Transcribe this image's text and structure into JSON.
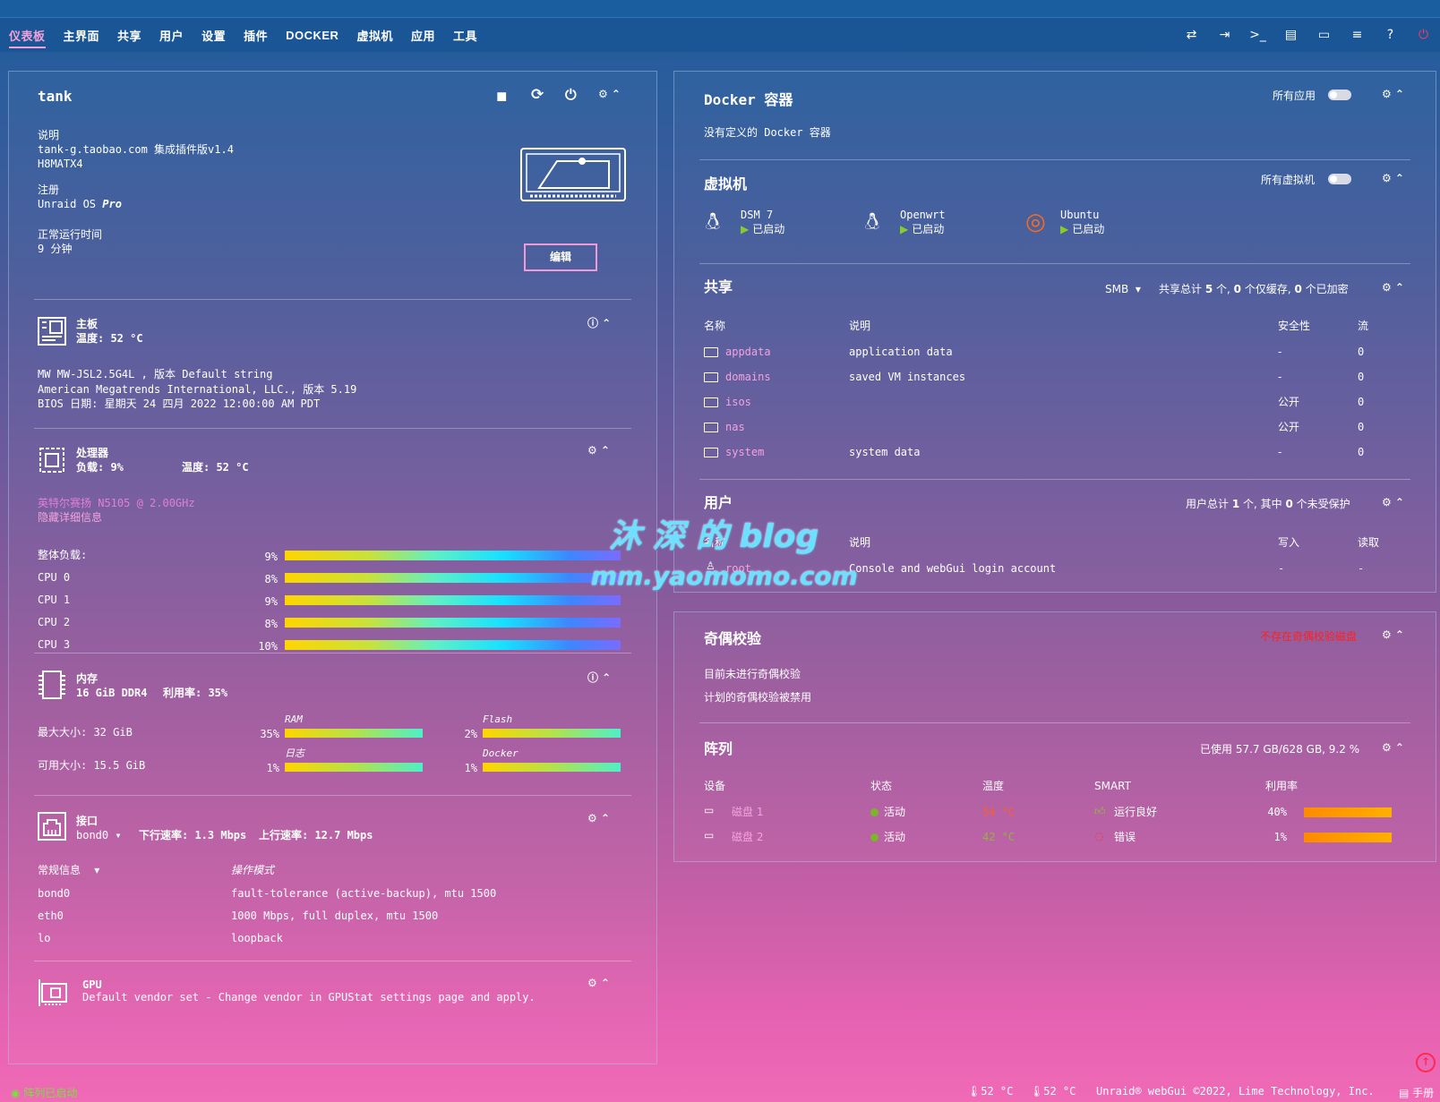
{
  "nav": {
    "items": [
      "仪表板",
      "主界面",
      "共享",
      "用户",
      "设置",
      "插件",
      "DOCKER",
      "虚拟机",
      "应用",
      "工具"
    ],
    "active": 0,
    "icons": [
      "switch-icon",
      "logout-icon",
      "terminal-icon",
      "feedback-icon",
      "monitor-icon",
      "log-icon",
      "help-icon",
      "power-icon"
    ]
  },
  "server": {
    "name": "tank",
    "desc_label": "说明",
    "desc_line1": "tank-g.taobao.com 集成插件版v1.4",
    "desc_line2": "H8MATX4",
    "reg_label": "注册",
    "reg_value": "Unraid OS ",
    "reg_value_em": "Pro",
    "uptime_label": "正常运行时间",
    "uptime_value": "9 分钟",
    "edit_label": "编辑"
  },
  "mb": {
    "title": "主板",
    "temp": "温度: 52 °C",
    "l1": "MW MW-JSL2.5G4L , 版本 Default string",
    "l2": "American Megatrends International, LLC., 版本 5.19",
    "l3": "BIOS 日期: 星期天 24 四月 2022 12:00:00 AM PDT"
  },
  "cpu": {
    "title": "处理器",
    "load": "负载: 9%",
    "temp": "温度: 52 °C",
    "model": "英特尔赛扬 N5105 @ 2.00GHz",
    "hide": "隐藏详细信息",
    "rows": [
      {
        "label": "整体负载:",
        "pct": "9%",
        "value": 9
      },
      {
        "label": "CPU 0",
        "pct": "8%",
        "value": 8
      },
      {
        "label": "CPU 1",
        "pct": "9%",
        "value": 9
      },
      {
        "label": "CPU 2",
        "pct": "8%",
        "value": 8
      },
      {
        "label": "CPU 3",
        "pct": "10%",
        "value": 10
      }
    ]
  },
  "mem": {
    "title": "内存",
    "summary": "16 GiB DDR4",
    "usage": "利用率: 35%",
    "max": "最大大小: 32 GiB",
    "avail": "可用大小: 15.5 GiB",
    "bars": [
      {
        "name": "RAM",
        "pct": "35%",
        "value": 35
      },
      {
        "name": "Flash",
        "pct": "2%",
        "value": 2
      },
      {
        "name": "日志",
        "pct": "1%",
        "value": 1
      },
      {
        "name": "Docker",
        "pct": "1%",
        "value": 1
      }
    ]
  },
  "net": {
    "title": "接口",
    "iface": "bond0",
    "down": "下行速率: 1.3 Mbps",
    "up": "上行速率: 12.7 Mbps",
    "general": "常规信息",
    "mode_label": "操作模式",
    "rows": [
      {
        "name": "bond0",
        "val": "fault-tolerance (active-backup), mtu 1500"
      },
      {
        "name": "eth0",
        "val": "1000 Mbps, full duplex, mtu 1500"
      },
      {
        "name": "lo",
        "val": "loopback"
      }
    ]
  },
  "gpu": {
    "title": "GPU",
    "desc": "Default vendor set - Change vendor in GPUStat settings page and apply."
  },
  "docker": {
    "title": "Docker 容器",
    "all_apps": "所有应用",
    "empty": "没有定义的 Docker 容器"
  },
  "vms": {
    "title": "虚拟机",
    "all": "所有虚拟机",
    "items": [
      {
        "name": "DSM 7",
        "state": "已启动"
      },
      {
        "name": "Openwrt",
        "state": "已启动"
      },
      {
        "name": "Ubuntu",
        "state": "已启动"
      }
    ]
  },
  "shares": {
    "title": "共享",
    "proto": "SMB",
    "summary_a": "共享总计 ",
    "summary_n1": "5",
    "summary_b": " 个, ",
    "summary_n2": "0",
    "summary_c": " 个仅缓存, ",
    "summary_n3": "0",
    "summary_d": " 个已加密",
    "headers": [
      "名称",
      "说明",
      "安全性",
      "流"
    ],
    "rows": [
      {
        "name": "appdata",
        "desc": "application data",
        "sec": "-",
        "stream": "0"
      },
      {
        "name": "domains",
        "desc": "saved VM instances",
        "sec": "-",
        "stream": "0"
      },
      {
        "name": "isos",
        "desc": "",
        "sec": "公开",
        "stream": "0"
      },
      {
        "name": "nas",
        "desc": "",
        "sec": "公开",
        "stream": "0"
      },
      {
        "name": "system",
        "desc": "system data",
        "sec": "-",
        "stream": "0"
      }
    ]
  },
  "users": {
    "title": "用户",
    "summary_a": "用户总计 ",
    "summary_n1": "1",
    "summary_b": " 个, 其中 ",
    "summary_n2": "0",
    "summary_c": " 个未受保护",
    "headers": [
      "名称",
      "说明",
      "写入",
      "读取"
    ],
    "rows": [
      {
        "name": "root",
        "desc": "Console and webGui login account",
        "write": "-",
        "read": "-"
      }
    ]
  },
  "parity": {
    "title": "奇偶校验",
    "warn": "不存在奇偶校验磁盘",
    "l1": "目前未进行奇偶校验",
    "l2": "计划的奇偶校验被禁用"
  },
  "array": {
    "title": "阵列",
    "used": "已使用 57.7 GB/628 GB, 9.2 %",
    "headers": [
      "设备",
      "状态",
      "温度",
      "SMART",
      "利用率"
    ],
    "rows": [
      {
        "name": "磁盘 1",
        "state": "活动",
        "temp": "54 °C",
        "smart": "运行良好",
        "pct": "40%",
        "value": 40
      },
      {
        "name": "磁盘 2",
        "state": "活动",
        "temp": "42 °C",
        "smart": "错误",
        "pct": "1%",
        "value": 1
      }
    ]
  },
  "watermark": {
    "l1": "沐 深 的 blog",
    "l2": "mm.yaomomo.com"
  },
  "footer": {
    "status": "阵列已启动",
    "t1": "52 °C",
    "t2": "52 °C",
    "copy": "Unraid® webGui ©2022, Lime Technology, Inc.",
    "manual": "手册"
  },
  "colors": {
    "accent": "#f3a3dc",
    "nav": "#1a5696",
    "warn": "#ff2020",
    "ok": "#7bb52a",
    "bar": "#ff8a00"
  }
}
